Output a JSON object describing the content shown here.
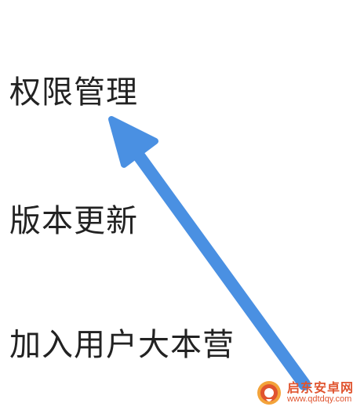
{
  "menu": {
    "items": [
      {
        "label": "权限管理"
      },
      {
        "label": "版本更新"
      },
      {
        "label": "加入用户大本营"
      }
    ]
  },
  "annotation": {
    "arrow_color": "#4a90e2",
    "icon": "arrow-up-left-icon"
  },
  "watermark": {
    "title": "启东安卓网",
    "url": "www.qdtdqy.com",
    "color": "#e0542f"
  }
}
